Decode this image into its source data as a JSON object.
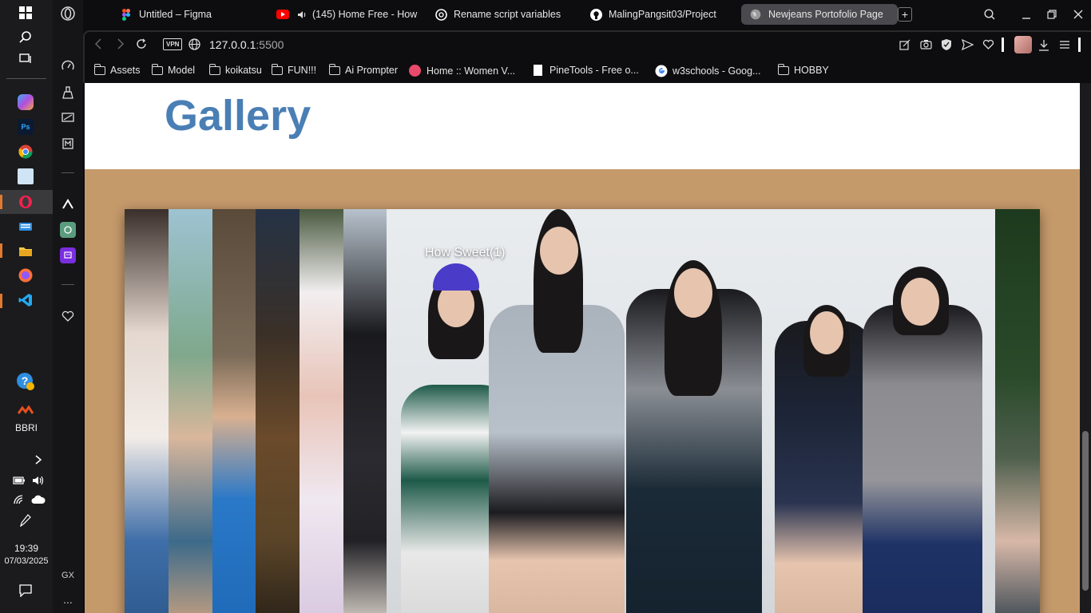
{
  "taskbar": {
    "label_app": "BBRI",
    "time": "19:39",
    "date": "07/03/2025"
  },
  "opera_sidebar": {
    "label_gx": "GX",
    "more": "..."
  },
  "tabs": [
    {
      "title": "Untitled – Figma",
      "icon": "figma-icon"
    },
    {
      "title": "(145) Home Free - How",
      "icon": "youtube-icon"
    },
    {
      "title": "Rename script variables",
      "icon": "chatgpt-icon"
    },
    {
      "title": "MalingPangsit03/Project",
      "icon": "github-icon"
    },
    {
      "title": "Newjeans Portofolio Page",
      "icon": "globe-icon",
      "active": true
    }
  ],
  "address": {
    "vpn": "VPN",
    "host": "127.0.0.1",
    "port": ":5500"
  },
  "bookmarks": [
    {
      "label": "Assets",
      "icon": "folder-icon"
    },
    {
      "label": "Model",
      "icon": "folder-icon"
    },
    {
      "label": "koikatsu",
      "icon": "folder-icon"
    },
    {
      "label": "FUN!!!",
      "icon": "folder-icon"
    },
    {
      "label": "Ai Prompter",
      "icon": "folder-icon"
    },
    {
      "label": "Home :: Women V...",
      "icon": "site-icon"
    },
    {
      "label": "PineTools - Free o...",
      "icon": "file-icon"
    },
    {
      "label": "w3schools - Goog...",
      "icon": "google-icon"
    },
    {
      "label": "HOBBY",
      "icon": "folder-icon"
    }
  ],
  "page": {
    "title": "Gallery",
    "caption": "How Sweet(1)"
  },
  "colors": {
    "title": "#4a7fb5",
    "background": "#c59a6b",
    "header_bg": "#ffffff"
  }
}
